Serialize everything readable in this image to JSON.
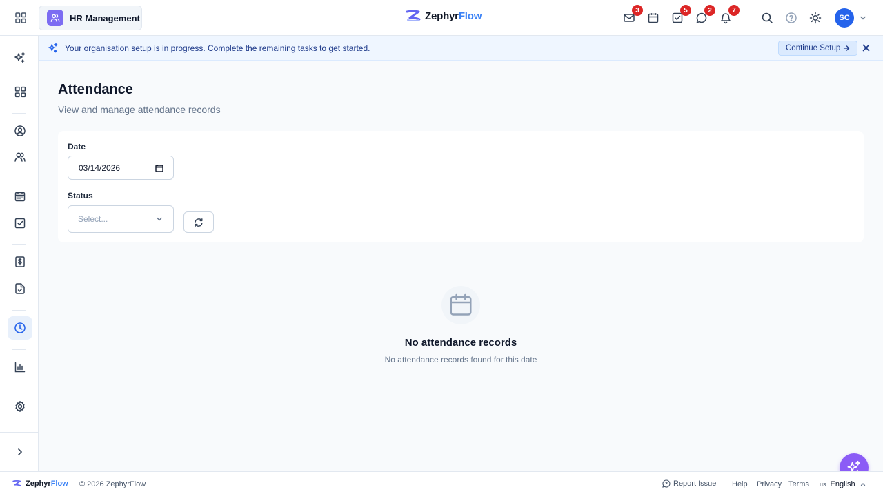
{
  "topbar": {
    "module_label": "HR Management",
    "logo_part1": "Zephyr",
    "logo_part2": "Flow",
    "badges": {
      "mail": "3",
      "tasks": "5",
      "chat": "2",
      "notifications": "7"
    },
    "avatar_initials": "SC"
  },
  "banner": {
    "message": "Your organisation setup is in progress. Complete the remaining tasks to get started.",
    "button_label": "Continue Setup"
  },
  "page": {
    "title": "Attendance",
    "subtitle": "View and manage attendance records"
  },
  "filters": {
    "date_label": "Date",
    "date_value": "03/14/2026",
    "status_label": "Status",
    "status_placeholder": "Select..."
  },
  "empty_state": {
    "title": "No attendance records",
    "message": "No attendance records found for this date"
  },
  "footer": {
    "logo_part1": "Zephyr",
    "logo_part2": "Flow",
    "copyright": "© 2026 ZephyrFlow",
    "report_issue": "Report Issue",
    "help": "Help",
    "privacy": "Privacy",
    "terms": "Terms",
    "lang_code": "us",
    "language": "English"
  },
  "colors": {
    "accent": "#2563eb",
    "module_icon": "#7c6cf2",
    "fab": "#8b5cf6",
    "badge": "#dc2626",
    "banner_bg": "#eff6ff"
  },
  "icons": {
    "sidebar": [
      "sparkle-icon",
      "dashboard-icon",
      "user-circle-icon",
      "users-icon",
      "calendar-icon",
      "check-square-icon",
      "dollar-file-icon",
      "file-check-icon",
      "clock-icon",
      "bar-chart-icon",
      "gear-icon",
      "chevron-right-icon"
    ]
  }
}
